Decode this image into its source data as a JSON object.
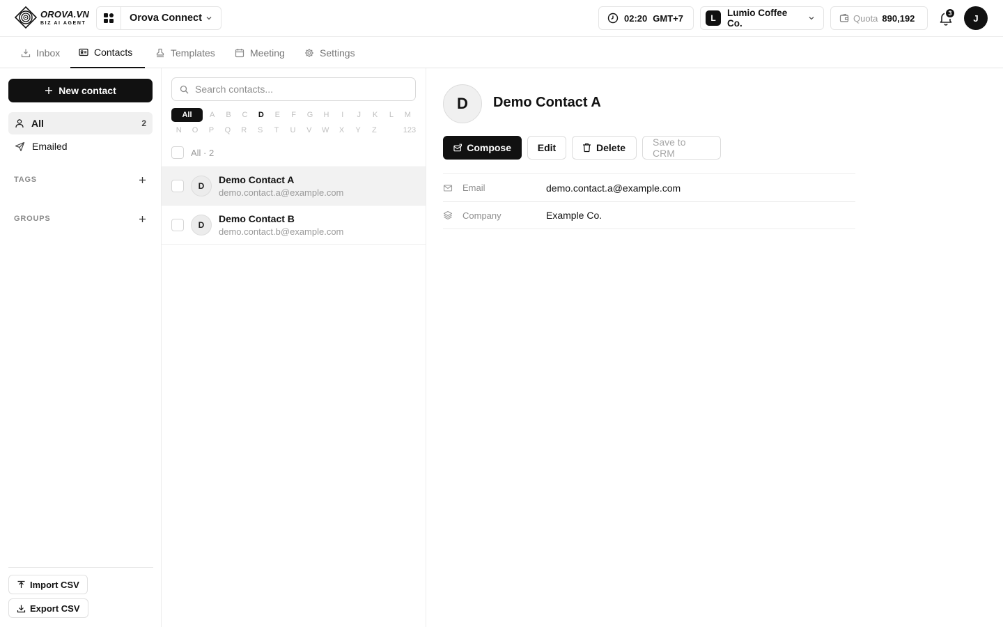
{
  "brand": {
    "name": "OROVA.VN",
    "tagline": "BIZ AI AGENT"
  },
  "app_switcher": {
    "name": "Orova Connect"
  },
  "header": {
    "time": "02:20",
    "timezone": "GMT+7",
    "org_initial": "L",
    "org_name": "Lumio Coffee Co.",
    "quota_label": "Quota",
    "quota_value": "890,192",
    "notification_count": "3",
    "user_initial": "J"
  },
  "tabs": [
    {
      "label": "Inbox",
      "icon": "inbox-icon"
    },
    {
      "label": "Contacts",
      "icon": "contact-card-icon",
      "active": true
    },
    {
      "label": "Templates",
      "icon": "stamp-icon"
    },
    {
      "label": "Meeting",
      "icon": "calendar-icon"
    },
    {
      "label": "Settings",
      "icon": "gear-icon"
    }
  ],
  "sidebar": {
    "new_contact_label": "New contact",
    "items": [
      {
        "label": "All",
        "count": "2",
        "icon": "user-icon",
        "active": true
      },
      {
        "label": "Emailed",
        "icon": "send-icon"
      }
    ],
    "tags_label": "TAGS",
    "groups_label": "GROUPS",
    "import_label": "Import CSV",
    "export_label": "Export CSV"
  },
  "list": {
    "search_placeholder": "Search contacts...",
    "alphabet_all": "All",
    "alphabet_row1": [
      "A",
      "B",
      "C",
      "D",
      "E",
      "F",
      "G",
      "H",
      "I",
      "J",
      "K",
      "L",
      "M"
    ],
    "alphabet_row2": [
      "N",
      "O",
      "P",
      "Q",
      "R",
      "S",
      "T",
      "U",
      "V",
      "W",
      "X",
      "Y",
      "Z"
    ],
    "alphabet_num": "123",
    "alphabet_active": "D",
    "select_all_label": "All · 2",
    "contacts": [
      {
        "initial": "D",
        "name": "Demo Contact A",
        "email": "demo.contact.a@example.com",
        "selected": true
      },
      {
        "initial": "D",
        "name": "Demo Contact B",
        "email": "demo.contact.b@example.com"
      }
    ]
  },
  "detail": {
    "initial": "D",
    "name": "Demo Contact A",
    "compose_label": "Compose",
    "edit_label": "Edit",
    "delete_label": "Delete",
    "save_crm_label": "Save to CRM",
    "fields": [
      {
        "label": "Email",
        "value": "demo.contact.a@example.com",
        "icon": "mail-icon"
      },
      {
        "label": "Company",
        "value": "Example Co.",
        "icon": "layers-icon"
      }
    ]
  }
}
